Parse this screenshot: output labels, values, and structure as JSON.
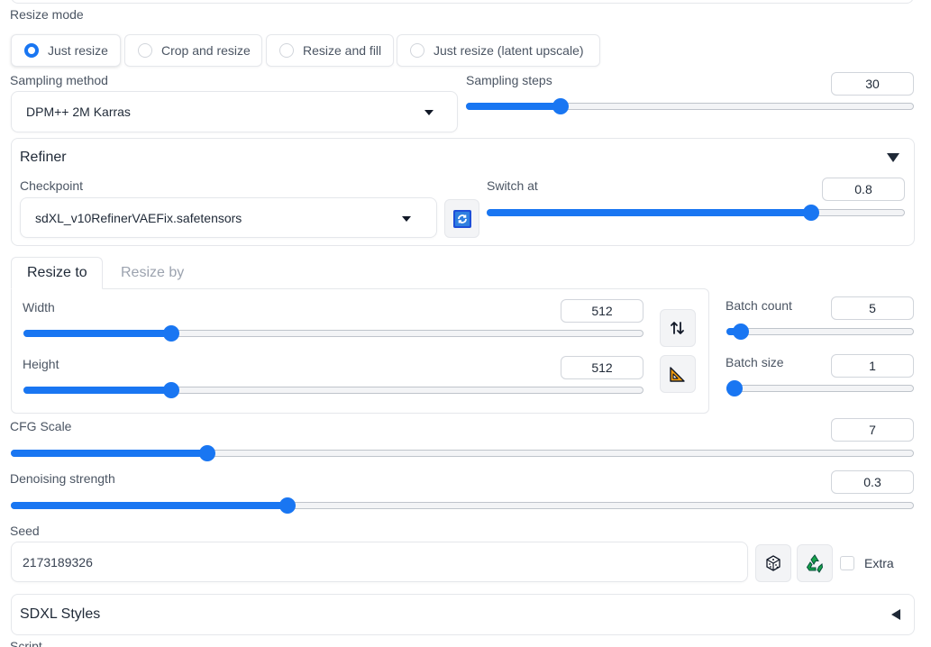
{
  "resize_mode": {
    "label": "Resize mode",
    "options": [
      "Just resize",
      "Crop and resize",
      "Resize and fill",
      "Just resize (latent upscale)"
    ],
    "selected": "Just resize"
  },
  "sampling": {
    "method_label": "Sampling method",
    "method_value": "DPM++ 2M Karras",
    "steps_label": "Sampling steps",
    "steps_value": "30",
    "steps_fraction": 0.2
  },
  "refiner": {
    "title": "Refiner",
    "checkpoint_label": "Checkpoint",
    "checkpoint_value": "sdXL_v10RefinerVAEFix.safetensors",
    "switch_label": "Switch at",
    "switch_value": "0.8",
    "switch_fraction": 0.786
  },
  "size_tabs": [
    "Resize to",
    "Resize by"
  ],
  "width": {
    "label": "Width",
    "value": "512",
    "fraction": 0.232
  },
  "height": {
    "label": "Height",
    "value": "512",
    "fraction": 0.232
  },
  "batch_count": {
    "label": "Batch count",
    "value": "5",
    "fraction": 0.036
  },
  "batch_size": {
    "label": "Batch size",
    "value": "1",
    "fraction": 0.0
  },
  "cfg": {
    "label": "CFG Scale",
    "value": "7",
    "fraction": 0.212
  },
  "denoise": {
    "label": "Denoising strength",
    "value": "0.3",
    "fraction": 0.303
  },
  "seed": {
    "label": "Seed",
    "value": "2173189326",
    "extra_label": "Extra"
  },
  "sdxl_styles": {
    "title": "SDXL Styles"
  },
  "script": {
    "label": "Script"
  },
  "colors": {
    "accent": "#1976f2",
    "recycle": "#16a34a"
  }
}
